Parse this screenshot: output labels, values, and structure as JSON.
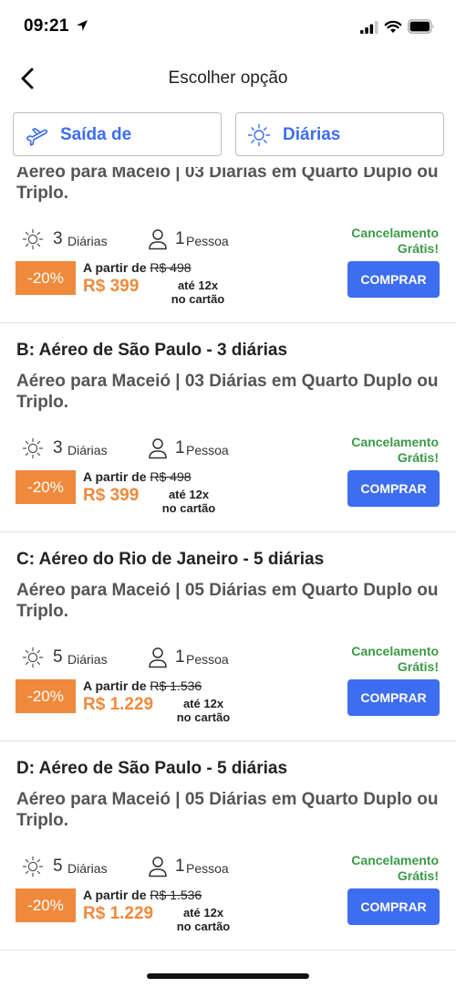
{
  "status_bar": {
    "time": "09:21"
  },
  "nav": {
    "title": "Escolher opção"
  },
  "filters": {
    "departure_label": "Saída de",
    "nights_label": "Diárias"
  },
  "cards": [
    {
      "title": "",
      "description": "Aéreo para Maceió | 03 Diárias em Quarto Duplo ou Triplo.",
      "nights": "3",
      "nights_label": "Diárias",
      "people": "1",
      "people_label": "Pessoa",
      "cancellation": "Cancelamento Grátis!",
      "discount": "-20%",
      "from_label": "A partir de",
      "old_price": "R$ 498",
      "price": "R$ 399",
      "installments": "até 12x",
      "installments_note": "no cartão",
      "buy_label": "COMPRAR"
    },
    {
      "title": "B: Aéreo de São Paulo - 3 diárias",
      "description": "Aéreo para Maceió | 03 Diárias em Quarto Duplo ou Triplo.",
      "nights": "3",
      "nights_label": "Diárias",
      "people": "1",
      "people_label": "Pessoa",
      "cancellation": "Cancelamento Grátis!",
      "discount": "-20%",
      "from_label": "A partir de",
      "old_price": "R$ 498",
      "price": "R$ 399",
      "installments": "até 12x",
      "installments_note": "no cartão",
      "buy_label": "COMPRAR"
    },
    {
      "title": "C: Aéreo do Rio de Janeiro - 5 diárias",
      "description": "Aéreo para Maceió | 05 Diárias em Quarto Duplo ou Triplo.",
      "nights": "5",
      "nights_label": "Diárias",
      "people": "1",
      "people_label": "Pessoa",
      "cancellation": "Cancelamento Grátis!",
      "discount": "-20%",
      "from_label": "A partir de",
      "old_price": "R$ 1.536",
      "price": "R$ 1.229",
      "installments": "até 12x",
      "installments_note": "no cartão",
      "buy_label": "COMPRAR"
    },
    {
      "title": "D: Aéreo de São Paulo - 5 diárias",
      "description": "Aéreo para Maceió | 05 Diárias em Quarto Duplo ou Triplo.",
      "nights": "5",
      "nights_label": "Diárias",
      "people": "1",
      "people_label": "Pessoa",
      "cancellation": "Cancelamento Grátis!",
      "discount": "-20%",
      "from_label": "A partir de",
      "old_price": "R$ 1.536",
      "price": "R$ 1.229",
      "installments": "até 12x",
      "installments_note": "no cartão",
      "buy_label": "COMPRAR"
    }
  ],
  "colors": {
    "accent": "#3d6df0",
    "discount": "#ef8a3c",
    "success": "#3b9a46"
  },
  "icons": [
    "location-arrow-icon",
    "signal-icon",
    "wifi-icon",
    "battery-icon",
    "back-chevron-icon",
    "airplane-icon",
    "sun-icon",
    "person-icon"
  ]
}
